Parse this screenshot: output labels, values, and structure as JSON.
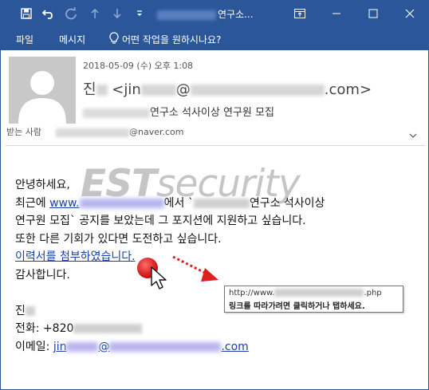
{
  "titlebar": {
    "title_suffix": "연구소...",
    "icons": [
      "save-icon",
      "undo-icon",
      "redo-icon",
      "up-arrow-icon",
      "down-arrow-icon",
      "customize-qat-icon"
    ],
    "window_buttons": [
      "ribbon-display-icon",
      "minimize-icon",
      "maximize-icon",
      "close-icon"
    ]
  },
  "ribbon": {
    "tab_file": "파일",
    "tab_message": "메시지",
    "tell_me": "어떤 작업을 원하시나요?"
  },
  "header": {
    "date": "2018-05-09 (수) 오후 1:08",
    "sender_name": "진",
    "sender_email_prefix": "<jin",
    "sender_email_at": "@",
    "sender_email_suffix": ".com>",
    "subject": "연구소 석사이상 연구원 모집",
    "to_label": "받는 사람",
    "to_email_suffix": "@naver.com"
  },
  "body": {
    "greeting": "안녕하세요,",
    "line2_a": "최근에 ",
    "line2_link": "www.",
    "line2_b": "에서 `",
    "line2_c": "연구소 석사이상",
    "line3": "연구원 모집` 공지를 보았는데 그 포지션에 지원하고 싶습니다.",
    "line4": "또한 다른 기회가 있다면 도전하고 싶습니다.",
    "attachment_link": "이력서를 첨부하였습니다.",
    "thanks": "감사합니다.",
    "sig_name": "진",
    "sig_phone_label": "전화: +820",
    "sig_email_label": "이메일: ",
    "sig_email_a": "jin",
    "sig_email_at": "@",
    "sig_email_suffix": ".com"
  },
  "watermark": {
    "est": "EST",
    "security": "security"
  },
  "tooltip": {
    "url_prefix": "http://www.",
    "url_suffix": ".php",
    "message": "링크를 따라가려면 클릭하거나 탭하세요."
  },
  "colors": {
    "titlebar_bg": "#2b579a",
    "link": "#1a3fa8",
    "annotation_red": "#e02020"
  }
}
